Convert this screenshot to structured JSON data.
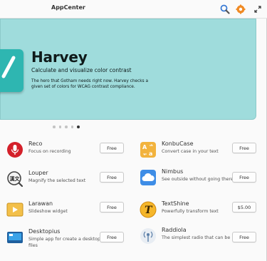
{
  "header": {
    "title": "AppCenter",
    "search_icon": "search-icon",
    "updates_icon": "updates-badge-icon",
    "fullscreen_icon": "fullscreen-icon"
  },
  "banner": {
    "app_name": "Harvey",
    "tagline": "Calculate and visualize color contrast",
    "description": "The hero that Gotham needs right now. Harvey checks a given set of colors for WCAG contrast compliance.",
    "background_color": "#9fdcdc",
    "dots_count": 5,
    "active_dot": 4
  },
  "apps": [
    {
      "name": "Reco",
      "description": "Focus on recording",
      "button": "Free",
      "icon": "microphone-icon"
    },
    {
      "name": "KonbuCase",
      "description": "Convert case in your text",
      "button": "Free",
      "icon": "case-convert-icon"
    },
    {
      "name": "Louper",
      "description": "Magnify the selected text",
      "button": "Free",
      "icon": "magnifier-text-icon"
    },
    {
      "name": "Nimbus",
      "description": "See outside without going there",
      "button": "Free",
      "icon": "cloud-icon"
    },
    {
      "name": "Larawan",
      "description": "Slideshow widget",
      "button": "Free",
      "icon": "slideshow-icon"
    },
    {
      "name": "TextShine",
      "description": "Powerfully transform text",
      "button": "$5.00",
      "icon": "text-shine-icon"
    },
    {
      "name": "Desktopius",
      "description": "Simple app for create a desktop files",
      "button": "Free",
      "icon": "desktop-icon"
    },
    {
      "name": "Raddiola",
      "description": "The simplest radio that can be",
      "button": "Free",
      "icon": "radio-antenna-icon"
    }
  ]
}
